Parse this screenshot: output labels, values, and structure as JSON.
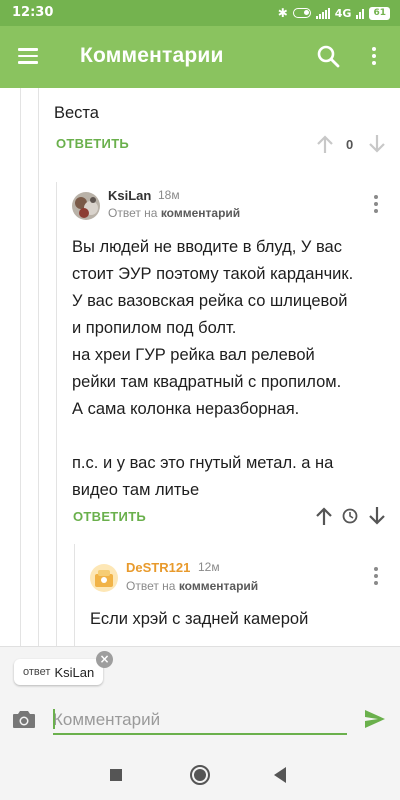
{
  "status_bar": {
    "time": "12:30",
    "network": "4G",
    "battery": "61"
  },
  "app_bar": {
    "title": "Комментарии",
    "menu_icon": "menu-icon",
    "search_icon": "search-icon",
    "more_icon": "more-vert-icon"
  },
  "comments": [
    {
      "text": "Веста",
      "reply_label": "ОТВЕТИТЬ",
      "score": "0"
    },
    {
      "author": "KsiLan",
      "age": "18м",
      "reply_to_prefix": "Ответ на",
      "reply_to_target": "комментарий",
      "text": "Вы людей не вводите в блуд,  У вас\nстоит ЭУР поэтому такой карданчик.\nУ вас вазовская рейка со шлицевой\nи пропилом под болт.\nна хреи ГУР рейка  вал релевой\nрейки там квадратный с пропилом.\nА сама колонка неразборная.\n\nп.с. и у вас это гнутый метал. а на\nвидео там литье",
      "reply_label": "ОТВЕТИТЬ"
    },
    {
      "author": "DeSTR121",
      "age": "12м",
      "reply_to_prefix": "Ответ на",
      "reply_to_target": "комментарий",
      "text": "Если хрэй с задней камерой"
    }
  ],
  "composer": {
    "reply_chip_label": "ответ",
    "reply_chip_name": "KsiLan",
    "input_placeholder": "Комментарий"
  },
  "colors": {
    "appbar": "#8ac35f",
    "statusbar": "#74b34f",
    "accent": "#6ab04c",
    "author2": "#e89a2c"
  }
}
